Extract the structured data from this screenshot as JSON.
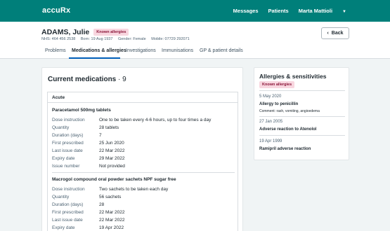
{
  "app": {
    "brand": "accuRx"
  },
  "topnav": {
    "messages": "Messages",
    "patients": "Patients",
    "user": "Marta Mattioli"
  },
  "patient": {
    "name": "ADAMS, Julie",
    "badge": "Known allergies",
    "nhs": "NHS: 464 456 2538",
    "born": "Born: 19 Aug 1937",
    "gender": "Gender: Female",
    "mobile": "Mobile: 07729 292071"
  },
  "back_label": "Back",
  "tabs": [
    "Problems",
    "Medications & allergies",
    "Investigations",
    "Immunisations",
    "GP & patient details"
  ],
  "medications": {
    "title": "Current medications",
    "count": "· 9",
    "group": "Acute",
    "items": [
      {
        "name": "Paracetamol 500mg tablets",
        "rows": [
          {
            "k": "Dose instruction",
            "v": "One to be taken every 4-6 hours, up to four times a day"
          },
          {
            "k": "Quantity",
            "v": "28 tablets"
          },
          {
            "k": "Duration (days)",
            "v": "7"
          },
          {
            "k": "First prescribed",
            "v": "25 Jun 2020"
          },
          {
            "k": "Last issue date",
            "v": "22 Mar 2022"
          },
          {
            "k": "Expiry date",
            "v": "29 Mar 2022"
          },
          {
            "k": "Issue number",
            "v": "Not provided"
          }
        ]
      },
      {
        "name": "Macrogol compound oral powder sachets NPF sugar free",
        "rows": [
          {
            "k": "Dose instruction",
            "v": "Two sachets to be taken each day"
          },
          {
            "k": "Quantity",
            "v": "56 sachets"
          },
          {
            "k": "Duration (days)",
            "v": "28"
          },
          {
            "k": "First prescribed",
            "v": "22 Mar 2022"
          },
          {
            "k": "Last issue date",
            "v": "22 Mar 2022"
          },
          {
            "k": "Expiry date",
            "v": "19 Apr 2022"
          }
        ]
      }
    ]
  },
  "allergies": {
    "title": "Allergies & sensitivities",
    "badge": "Known allergies",
    "items": [
      {
        "date": "5 May 2020",
        "name": "Allergy to penicillin",
        "comment": "Comment: rash, vomiting, angioedema"
      },
      {
        "date": "27 Jan 2005",
        "name": "Adverse reaction to Atenolol"
      },
      {
        "date": "19 Apr 1999",
        "name": "Ramipril adverse reaction"
      }
    ]
  }
}
